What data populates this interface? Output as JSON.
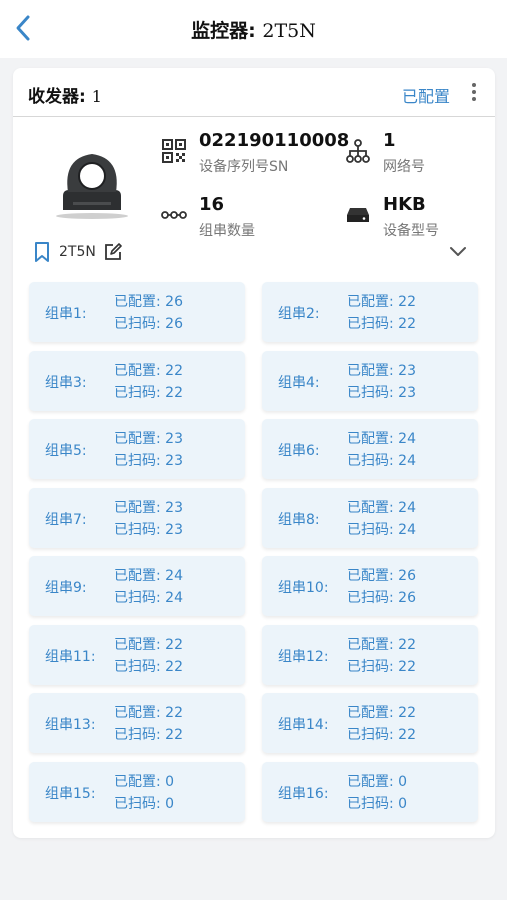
{
  "header": {
    "title_label": "监控器:",
    "title_value": "2T5N"
  },
  "receiver": {
    "label": "收发器:",
    "value": "1",
    "status": "已配置"
  },
  "device": {
    "sn_value": "022190110008",
    "sn_label": "设备序列号SN",
    "network_value": "1",
    "network_label": "网络号",
    "string_count_value": "16",
    "string_count_label": "组串数量",
    "model_value": "HKB",
    "model_label": "设备型号"
  },
  "tag": {
    "name": "2T5N"
  },
  "strings": [
    {
      "name": "组串1:",
      "configured": "已配置: 26",
      "scanned": "已扫码: 26"
    },
    {
      "name": "组串2:",
      "configured": "已配置: 22",
      "scanned": "已扫码: 22"
    },
    {
      "name": "组串3:",
      "configured": "已配置: 22",
      "scanned": "已扫码: 22"
    },
    {
      "name": "组串4:",
      "configured": "已配置: 23",
      "scanned": "已扫码: 23"
    },
    {
      "name": "组串5:",
      "configured": "已配置: 23",
      "scanned": "已扫码: 23"
    },
    {
      "name": "组串6:",
      "configured": "已配置: 24",
      "scanned": "已扫码: 24"
    },
    {
      "name": "组串7:",
      "configured": "已配置: 23",
      "scanned": "已扫码: 23"
    },
    {
      "name": "组串8:",
      "configured": "已配置: 24",
      "scanned": "已扫码: 24"
    },
    {
      "name": "组串9:",
      "configured": "已配置: 24",
      "scanned": "已扫码: 24"
    },
    {
      "name": "组串10:",
      "configured": "已配置: 26",
      "scanned": "已扫码: 26"
    },
    {
      "name": "组串11:",
      "configured": "已配置: 22",
      "scanned": "已扫码: 22"
    },
    {
      "name": "组串12:",
      "configured": "已配置: 22",
      "scanned": "已扫码: 22"
    },
    {
      "name": "组串13:",
      "configured": "已配置: 22",
      "scanned": "已扫码: 22"
    },
    {
      "name": "组串14:",
      "configured": "已配置: 22",
      "scanned": "已扫码: 22"
    },
    {
      "name": "组串15:",
      "configured": "已配置: 0",
      "scanned": "已扫码: 0"
    },
    {
      "name": "组串16:",
      "configured": "已配置: 0",
      "scanned": "已扫码: 0"
    }
  ],
  "icons": {
    "back": "chevron-left-icon",
    "more": "more-vertical-icon",
    "sn": "qr-code-icon",
    "network": "network-tree-icon",
    "string_count": "string-chain-icon",
    "model": "hard-drive-icon",
    "tag": "bookmark-icon",
    "edit": "edit-icon",
    "expand": "chevron-down-icon"
  },
  "colors": {
    "accent": "#3a86c8",
    "tile_bg": "#ecf4fa",
    "page_bg": "#f2f3f5"
  }
}
